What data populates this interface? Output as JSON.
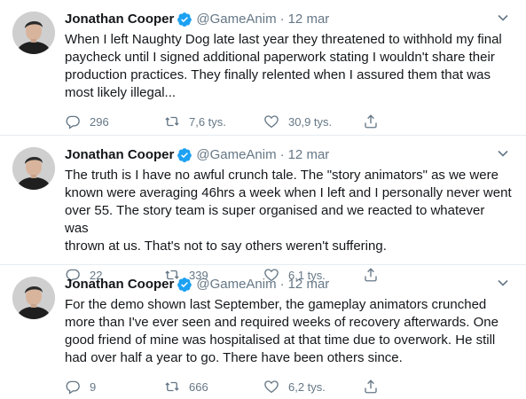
{
  "tweets": [
    {
      "name": "Jonathan Cooper",
      "handle": "@GameAnim",
      "dot": "·",
      "date": "12 mar",
      "text": "When I left Naughty Dog late last year they threatened to withhold my final\npaycheck until I signed additional paperwork stating I wouldn't share their\nproduction practices. They finally relented when I assured them that was\nmost likely illegal...",
      "replies": "296",
      "retweets": "7,6 tys.",
      "likes": "30,9 tys."
    },
    {
      "name": "Jonathan Cooper",
      "handle": "@GameAnim",
      "dot": "·",
      "date": "12 mar",
      "text": "The truth is I have no awful crunch tale. The \"story animators\" as we were\nknown were averaging 46hrs a week when I left and I personally never went\nover 55. The story team is super organised and we reacted to whatever was\nthrown at us. That's not to say others weren't suffering.",
      "replies": "22",
      "retweets": "339",
      "likes": "6,1 tys."
    },
    {
      "name": "Jonathan Cooper",
      "handle": "@GameAnim",
      "dot": "·",
      "date": "12 mar",
      "text": "For the demo shown last September, the gameplay animators crunched\nmore than I've ever seen and required weeks of recovery afterwards. One\ngood friend of mine was hospitalised at that time due to overwork. He still\nhad over half a year to go. There have been others since.",
      "replies": "9",
      "retweets": "666",
      "likes": "6,2 tys."
    }
  ],
  "icons": {
    "reply": "reply-icon",
    "retweet": "retweet-icon",
    "like": "heart-icon",
    "share": "share-icon",
    "verified": "verified-badge-icon",
    "more": "chevron-down-icon"
  },
  "colors": {
    "verified": "#1da1f2",
    "secondary_text": "#657786",
    "primary_text": "#14171a"
  }
}
